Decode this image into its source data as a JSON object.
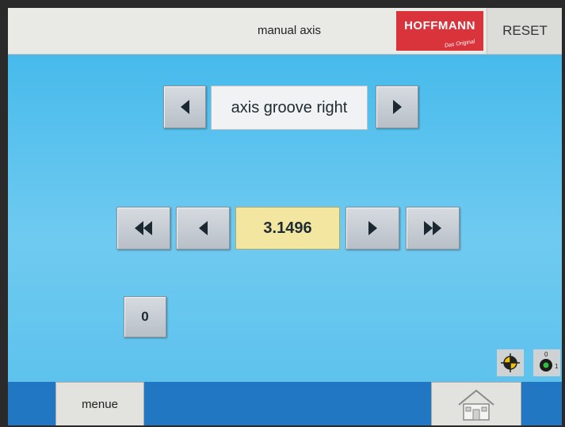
{
  "header": {
    "title": "manual axis",
    "logo_text": "HOFFMANN",
    "logo_tagline": "Das Original",
    "reset_label": "RESET"
  },
  "axis_selector": {
    "value": "axis groove right",
    "prev_icon": "left-triangle",
    "next_icon": "right-triangle"
  },
  "jog": {
    "value": "3.1496",
    "fast_back_icon": "double-left-triangle",
    "back_icon": "left-triangle",
    "forward_icon": "right-triangle",
    "fast_forward_icon": "double-right-triangle"
  },
  "zero_button": {
    "label": "0"
  },
  "status_icons": {
    "reference_icon": "reference-target",
    "tool_icon": "tool-indicator",
    "tool_label_top": "0",
    "tool_label_right": "1"
  },
  "footer": {
    "menu_label": "menue",
    "home_icon": "house"
  },
  "colors": {
    "background": "#4fbdec",
    "value_field": "#f2e6a0",
    "bottom_bar": "#2177c2",
    "logo": "#d9333b"
  }
}
